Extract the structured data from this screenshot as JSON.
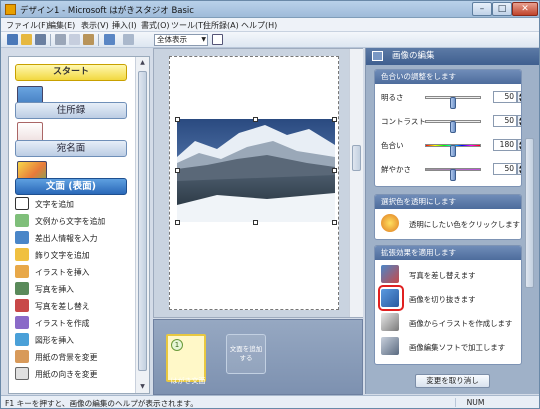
{
  "window": {
    "title": "デザイン1 - Microsoft はがきスタジオ Basic",
    "min": "–",
    "max": "□",
    "close": "✕"
  },
  "menu": [
    "ファイル(F)",
    "編集(E)",
    "表示(V)",
    "挿入(I)",
    "書式(O)",
    "ツール(T)",
    "住所録(A)",
    "ヘルプ(H)"
  ],
  "toolbar": {
    "zoom_value": "全体表示"
  },
  "left": {
    "start": "スタート",
    "nav": [
      {
        "label": "住所録"
      },
      {
        "label": "宛名面"
      },
      {
        "label": "文面 (表面)"
      }
    ],
    "items": [
      "文字を追加",
      "文例から文字を追加",
      "差出人情報を入力",
      "飾り文字を追加",
      "イラストを挿入",
      "写真を挿入",
      "写真を差し替え",
      "イラストを作成",
      "図形を挿入",
      "用紙の背景を変更",
      "用紙の向きを変更"
    ]
  },
  "center": {
    "thumb_num": "1",
    "thumb_label": "はがき文面",
    "thumb_add": "文面を追加する"
  },
  "right": {
    "header": "画像の編集",
    "sec1": {
      "title": "色合いの調整をします",
      "sliders": [
        {
          "label": "明るさ",
          "value": "50",
          "level": 0.5
        },
        {
          "label": "コントラスト",
          "value": "50",
          "level": 0.5
        },
        {
          "label": "色合い",
          "value": "180",
          "level": 0.5
        },
        {
          "label": "鮮やかさ",
          "value": "50",
          "level": 0.5
        }
      ]
    },
    "sec2": {
      "title": "選択色を透明にします",
      "item": "透明にしたい色をクリックします"
    },
    "sec3": {
      "title": "拡張効果を適用します",
      "items": [
        "写真を差し替えます",
        "画像を切り抜きます",
        "画像からイラストを作成します",
        "画像編集ソフトで加工します"
      ]
    },
    "undo": "変更を取り消し"
  },
  "status": {
    "text": "F1 キーを押すと、画像の編集のヘルプが表示されます。",
    "num": "NUM"
  },
  "colors": {
    "accent": "#3f5f8f",
    "highlight": "#e02020",
    "start": "#f2d840"
  }
}
